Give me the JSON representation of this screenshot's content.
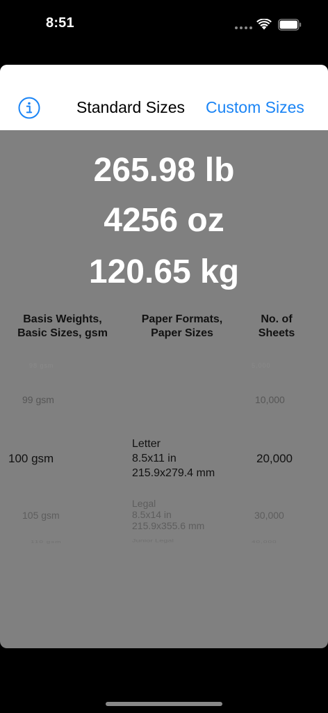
{
  "status": {
    "time": "8:51"
  },
  "header": {
    "standard_label": "Standard Sizes",
    "custom_label": "Custom Sizes"
  },
  "weights": {
    "lb": "265.98 lb",
    "oz": "4256 oz",
    "kg": "120.65 kg"
  },
  "columns": {
    "basis": "Basis Weights, Basic Sizes, gsm",
    "format": "Paper Formats, Paper Sizes",
    "sheets": "No. of Sheets"
  },
  "picker": {
    "row_top_dim": {
      "basis": "98 gsm",
      "sheets": "5,000"
    },
    "row1": {
      "basis": "99 gsm",
      "sheets": "10,000"
    },
    "selected": {
      "basis": "100 gsm",
      "format": "Letter\n8.5x11 in\n215.9x279.4 mm",
      "sheets": "20,000"
    },
    "row3": {
      "basis": "105 gsm",
      "format": "Legal\n8.5x14 in\n215.9x355.6 mm",
      "sheets": "30,000"
    },
    "row4": {
      "basis": "110 gsm",
      "format": "Junior Legal",
      "sheets": "40,000"
    }
  },
  "colors": {
    "accent": "#1a84f5",
    "overlay": "#808080"
  }
}
